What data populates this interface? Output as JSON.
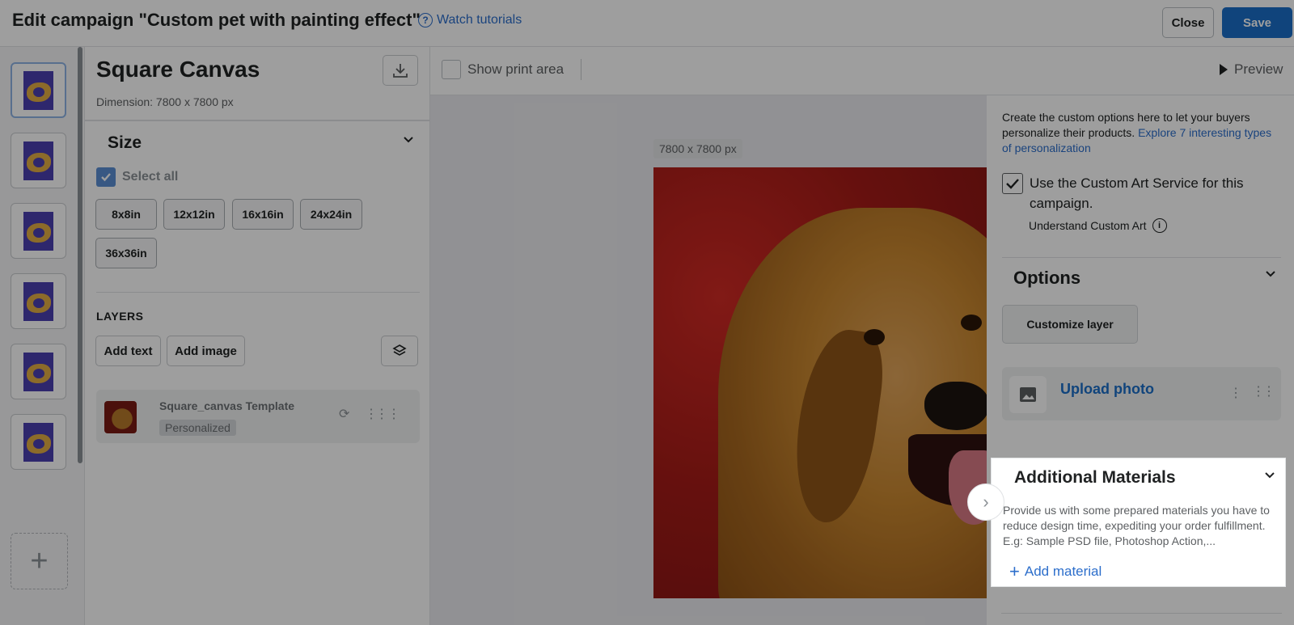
{
  "header": {
    "title": "Edit campaign \"Custom pet with painting effect\"",
    "tutorials": "Watch tutorials",
    "close": "Close",
    "save": "Save"
  },
  "left": {
    "product_title": "Square Canvas",
    "dimension": "Dimension: 7800 x 7800 px",
    "size_heading": "Size",
    "select_all": "Select all",
    "sizes": [
      "8x8in",
      "12x12in",
      "16x16in",
      "24x24in",
      "36x36in"
    ],
    "layers_heading": "LAYERS",
    "add_text": "Add text",
    "add_image": "Add image",
    "layer": {
      "name": "Square_canvas Template",
      "badge": "Personalized"
    }
  },
  "canvas": {
    "show_print_area": "Show print area",
    "preview": "Preview",
    "dim_label": "7800 x 7800 px"
  },
  "right": {
    "intro": "Create the custom options here to let your buyers personalize their products.",
    "intro_link": "Explore 7 interesting types of personalization",
    "custom_art": "Use the Custom Art Service for this campaign.",
    "understand": "Understand Custom Art",
    "options_heading": "Options",
    "customize_layer": "Customize layer",
    "upload_photo": "Upload photo"
  },
  "additional": {
    "title": "Additional Materials",
    "desc": "Provide us with some prepared materials you have to reduce design time, expediting your order fulfillment. E.g: Sample PSD file, Photoshop Action,...",
    "add_link": "Add material"
  },
  "colors": {
    "accent": "#1b6fc9",
    "link": "#2c6ecb"
  }
}
